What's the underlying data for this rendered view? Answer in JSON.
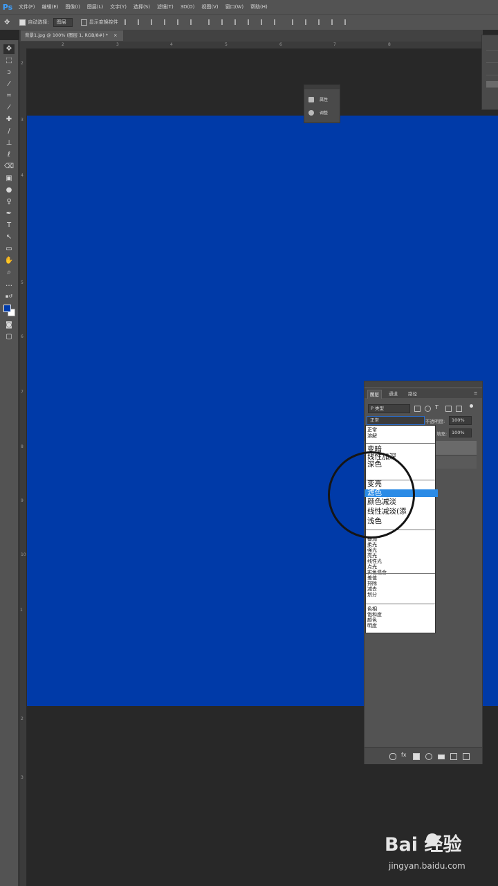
{
  "app": {
    "logo": "Ps"
  },
  "menu": [
    "文件(F)",
    "编辑(E)",
    "图像(I)",
    "图层(L)",
    "文字(Y)",
    "选择(S)",
    "滤镜(T)",
    "3D(D)",
    "视图(V)",
    "窗口(W)",
    "帮助(H)"
  ],
  "options": {
    "auto_select_label": "自动选择:",
    "auto_select_target": "图层",
    "show_transform_label": "显示变换控件"
  },
  "document": {
    "tab_title": "背景1.jpg @ 100% (图层 1, RGB/8#) *"
  },
  "ruler_marks": {
    "top": [
      "2",
      "3",
      "4",
      "5",
      "6",
      "7",
      "8"
    ],
    "left": [
      "2",
      "3",
      "4",
      "5",
      "6",
      "7",
      "8",
      "9",
      "10",
      "1",
      "2",
      "3"
    ]
  },
  "canvas": {
    "color": "#003aa8"
  },
  "adjust_panel": {
    "item1": "属性",
    "item2": "调整"
  },
  "layers_panel": {
    "tabs": [
      "图层",
      "通道",
      "路径"
    ],
    "kind_filter": "P 类型",
    "blend_mode": "正常",
    "opacity_label": "不透明度:",
    "opacity_value": "100%",
    "fill_label": "填充:",
    "fill_value": "100%"
  },
  "blend_modes": {
    "group1": [
      "正常",
      "溶解"
    ],
    "group2": [
      "变暗",
      "线性加深",
      "深色"
    ],
    "group3": [
      "变亮",
      "滤色",
      "颜色减淡",
      "线性减淡(添",
      "浅色"
    ],
    "selected": "滤色",
    "group4": [
      "叠加",
      "柔光",
      "强光",
      "亮光",
      "线性光",
      "点光",
      "实色混合"
    ],
    "group5": [
      "差值",
      "排除",
      "减去",
      "划分"
    ],
    "group6": [
      "色相",
      "饱和度",
      "颜色",
      "明度"
    ]
  },
  "watermark": {
    "main": "Bai 经验",
    "sub": "jingyan.baidu.com"
  }
}
